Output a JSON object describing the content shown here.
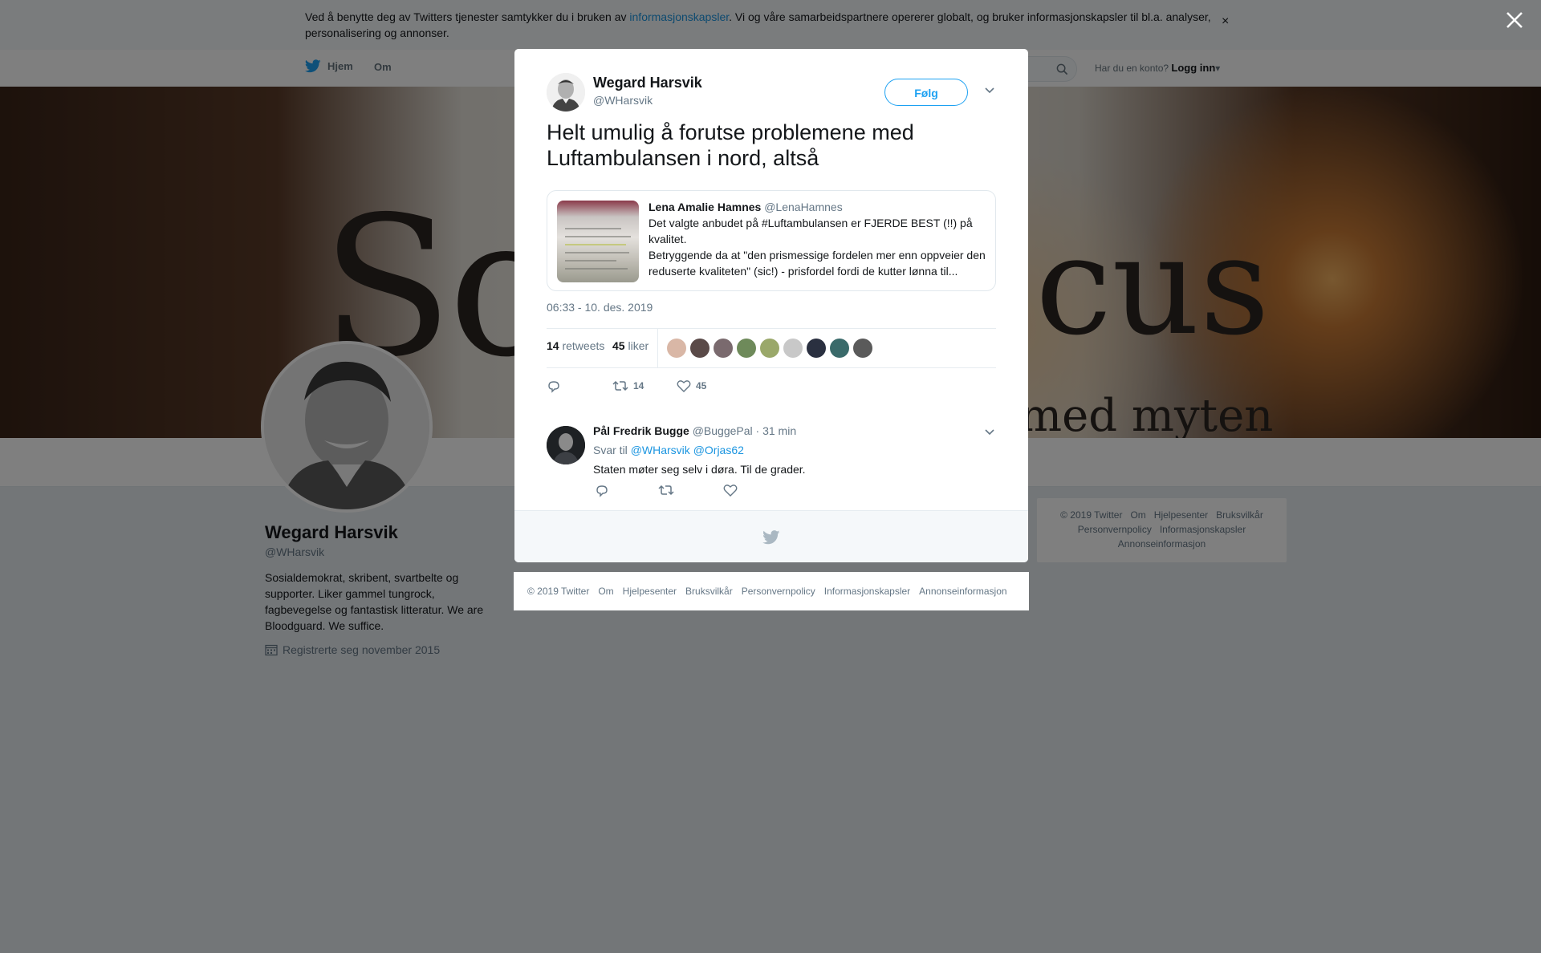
{
  "cookie": {
    "text_before": "Ved å benytte deg av Twitters tjenester samtykker du i bruken av ",
    "link": "informasjonskapsler",
    "text_after": ". Vi og våre samarbeidspartnere opererer globalt, og bruker informasjonskapsler til bl.a. analyser, personalisering og annonser.",
    "close": "×"
  },
  "topnav": {
    "home": "Hjem",
    "about": "Om",
    "account_prompt": "Har du en konto?",
    "login": "Logg inn"
  },
  "banner": {
    "text_left": "So",
    "text_right": "cus",
    "text_bottom": "med myten"
  },
  "profile": {
    "name": "Wegard Harsvik",
    "handle": "@WHarsvik",
    "bio": "Sosialdemokrat, skribent, svartbelte og supporter. Liker gammel tungrock, fagbevegelse og fantastisk litteratur. We are Bloodguard. We suffice.",
    "joined": "Registrerte seg november 2015"
  },
  "right_footer": {
    "items": [
      "© 2019 Twitter",
      "Om",
      "Hjelpesenter",
      "Bruksvilkår",
      "Personvernpolicy",
      "Informasjonskapsler",
      "Annonseinformasjon"
    ]
  },
  "tweet": {
    "author_name": "Wegard Harsvik",
    "author_handle": "@WHarsvik",
    "follow_label": "Følg",
    "text": "Helt umulig å forutse problemene med Luftambulansen i nord, altså",
    "quote": {
      "name": "Lena Amalie Hamnes",
      "handle": "@LenaHamnes",
      "line1": "Det valgte anbudet på #Luftambulansen er  FJERDE BEST (!!) på kvalitet.",
      "line2": "Betryggende da at \"den prismessige fordelen mer enn oppveier den reduserte kvaliteten\" (sic!) - prisfordel fordi de kutter lønna til..."
    },
    "timestamp": "06:33 - 10. des. 2019",
    "retweets_count": "14",
    "retweets_label": "retweets",
    "likes_count": "45",
    "likes_label": "liker",
    "action_retweets": "14",
    "action_likes": "45",
    "liker_colors": [
      "#d9b7a6",
      "#5a4a48",
      "#7a6a6e",
      "#6e8a5a",
      "#9aa86a",
      "#c8c8c8",
      "#2a3040",
      "#3a6a6a",
      "#5a5a5a"
    ]
  },
  "reply": {
    "name": "Pål Fredrik Bugge",
    "handle": "@BuggePal",
    "time": "· 31 min",
    "reply_to_label": "Svar til ",
    "mention1": "@WHarsvik",
    "mention2": "@Orjas62",
    "text": "Staten møter seg selv i døra. Til de grader."
  },
  "modal_footer": {
    "items": [
      "© 2019 Twitter",
      "Om",
      "Hjelpesenter",
      "Bruksvilkår",
      "Personvernpolicy",
      "Informasjonskapsler",
      "Annonseinformasjon"
    ]
  },
  "colors": {
    "accent": "#1da1f2",
    "link": "#1b95e0",
    "muted": "#657786"
  }
}
